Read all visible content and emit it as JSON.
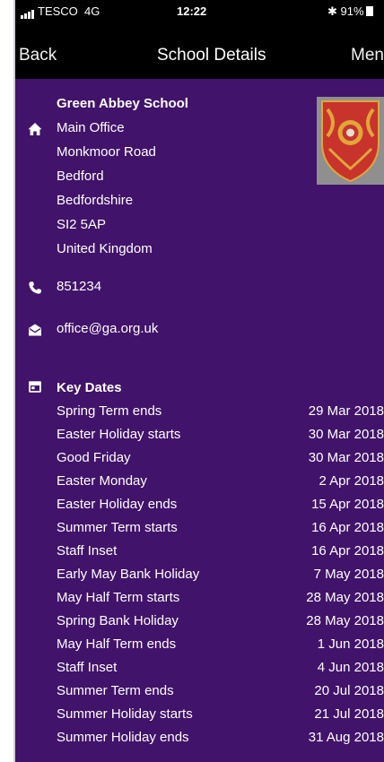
{
  "status_bar": {
    "carrier": "TESCO",
    "network": "4G",
    "time": "12:22",
    "battery": "91%"
  },
  "nav": {
    "back_label": "Back",
    "title": "School Details",
    "menu_label": "Menu"
  },
  "school": {
    "name": "Green Abbey School",
    "address": [
      "Main Office",
      "Monkmoor Road",
      "Bedford",
      "Bedfordshire",
      "SI2 5AP",
      "United Kingdom"
    ],
    "phone": "851234",
    "email": "office@ga.org.uk"
  },
  "key_dates": {
    "heading": "Key Dates",
    "items": [
      {
        "event": "Spring Term ends",
        "date": "29 Mar 2018"
      },
      {
        "event": "Easter Holiday starts",
        "date": "30 Mar 2018"
      },
      {
        "event": "Good Friday",
        "date": "30 Mar 2018"
      },
      {
        "event": "Easter Monday",
        "date": "2 Apr 2018"
      },
      {
        "event": "Easter Holiday ends",
        "date": "15 Apr 2018"
      },
      {
        "event": "Summer Term starts",
        "date": "16 Apr 2018"
      },
      {
        "event": "Staff Inset",
        "date": "16 Apr 2018"
      },
      {
        "event": "Early May Bank Holiday",
        "date": "7 May 2018"
      },
      {
        "event": "May Half Term starts",
        "date": "28 May 2018"
      },
      {
        "event": "Spring Bank Holiday",
        "date": "28 May 2018"
      },
      {
        "event": "May Half Term ends",
        "date": "1 Jun 2018"
      },
      {
        "event": "Staff Inset",
        "date": "4 Jun 2018"
      },
      {
        "event": "Summer Term ends",
        "date": "20 Jul 2018"
      },
      {
        "event": "Summer Holiday starts",
        "date": "21 Jul 2018"
      },
      {
        "event": "Summer Holiday ends",
        "date": "31 Aug 2018"
      }
    ]
  },
  "icons": {
    "address": "home-icon",
    "phone": "phone-icon",
    "email": "envelope-icon",
    "dates": "calendar-icon",
    "crest": "school-crest-logo"
  },
  "colors": {
    "background": "#41136a",
    "bar": "#000000",
    "text": "#ffffff",
    "crest_red": "#c8332c",
    "crest_gold": "#e0a63a"
  }
}
